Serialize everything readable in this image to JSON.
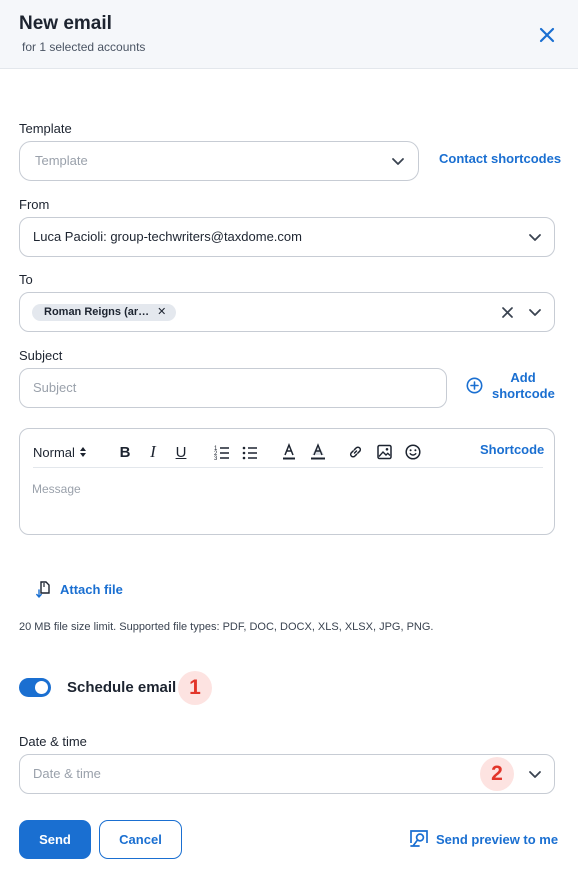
{
  "header": {
    "title": "New email",
    "subtitle": "for 1 selected accounts"
  },
  "template": {
    "label": "Template",
    "placeholder": "Template",
    "shortcodes_link": "Contact shortcodes"
  },
  "from": {
    "label": "From",
    "value": "Luca Pacioli: group-techwriters@taxdome.com"
  },
  "to": {
    "label": "To",
    "chips": [
      "Roman Reigns (ar…"
    ]
  },
  "subject": {
    "label": "Subject",
    "placeholder": "Subject",
    "add_shortcode_line1": "Add",
    "add_shortcode_line2": "shortcode"
  },
  "editor": {
    "format_select": "Normal",
    "shortcode_link": "Shortcode",
    "message_placeholder": "Message"
  },
  "attach": {
    "label": "Attach file",
    "hint": "20 MB file size limit. Supported file types: PDF, DOC, DOCX, XLS, XLSX, JPG, PNG."
  },
  "schedule": {
    "label": "Schedule email",
    "enabled": true,
    "badge": "1"
  },
  "datetime": {
    "label": "Date & time",
    "placeholder": "Date & time",
    "badge": "2"
  },
  "footer": {
    "send": "Send",
    "cancel": "Cancel",
    "preview": "Send preview to me"
  },
  "colors": {
    "accent": "#1a6fd1",
    "badge_bg": "#fde3e1",
    "badge_text": "#e2352a"
  }
}
